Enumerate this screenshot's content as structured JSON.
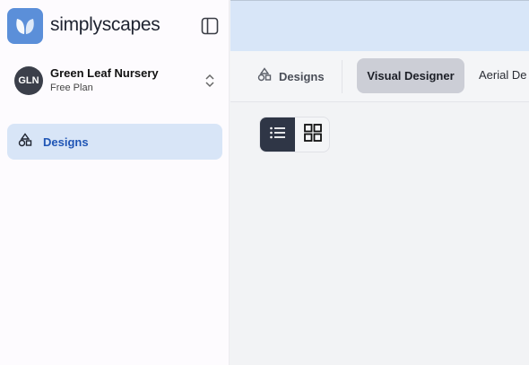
{
  "brand": {
    "name_part1": "simply",
    "name_part2": "scapes",
    "logo_icon": "leaf-icon",
    "accent": "#5b8fd9"
  },
  "sidebar": {
    "toggle_icon": "sidebar-toggle-icon",
    "org": {
      "avatar_initials": "GLN",
      "name": "Green Leaf Nursery",
      "plan": "Free Plan",
      "switch_icon": "chevron-up-down-icon"
    },
    "items": [
      {
        "label": "Designs",
        "icon": "shapes-icon",
        "active": true
      }
    ]
  },
  "tabs": {
    "designs_label": "Designs",
    "visual_designer_label": "Visual Designer",
    "aerial_label": "Aerial De"
  },
  "view_toggle": {
    "selected": "list",
    "options": [
      "list",
      "grid"
    ]
  },
  "colors": {
    "active_nav_bg": "#d8e5f7",
    "active_nav_text": "#1f55b5",
    "topbar_bg": "#d8e6f8",
    "toggle_active_bg": "#2f3646"
  }
}
